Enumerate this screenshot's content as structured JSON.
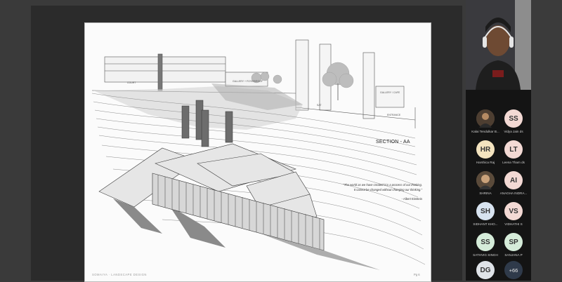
{
  "slide": {
    "section_label": "SECTION - AA",
    "quote_line1": "\"The world as we have created it is a process of our thinking.",
    "quote_line2": "It cannot be changed without changing our thinking.\"",
    "quote_author": "- Albert Einstein",
    "labels": {
      "court": "COURT",
      "gallery_left": "GALLERY + FOYER/ROOF",
      "gallery_right": "GALLERY / CAFE",
      "sat": "SAT",
      "entrance": "ENTRANCE"
    },
    "footer_left": "SOMAIYA · LANDSCAPE DESIGN",
    "footer_right": "Pg 6"
  },
  "participants": [
    {
      "name": "Kalai Tendulkar B...",
      "initials": "",
      "color": "#6b5a49",
      "photo": true
    },
    {
      "name": "Vidya Jain ds",
      "initials": "SS",
      "color": "#f3d9d4",
      "photo": false
    },
    {
      "name": "Harshica Raj",
      "initials": "HR",
      "color": "#f3e3bf",
      "photo": false
    },
    {
      "name": "Leena Tham ds",
      "initials": "LT",
      "color": "#f3d9d4",
      "photo": false
    },
    {
      "name": "SHRINA",
      "initials": "",
      "color": "#7a6a55",
      "photo": true
    },
    {
      "name": "ANAGHA INDRA...",
      "initials": "AI",
      "color": "#f3d9d4",
      "photo": false
    },
    {
      "name": "SIDHANT KHO...",
      "initials": "SH",
      "color": "#d8e3f0",
      "photo": false
    },
    {
      "name": "VIDHATHI S",
      "initials": "VS",
      "color": "#f3d9d4",
      "photo": false
    },
    {
      "name": "SATHVIG SINGH",
      "initials": "SS",
      "color": "#d5ecd9",
      "photo": false
    },
    {
      "name": "SANJANA P",
      "initials": "SP",
      "color": "#d5ecd9",
      "photo": false
    },
    {
      "name": "",
      "initials": "DG",
      "color": "#dfe3e8",
      "photo": false
    }
  ],
  "more_participants": "+66"
}
